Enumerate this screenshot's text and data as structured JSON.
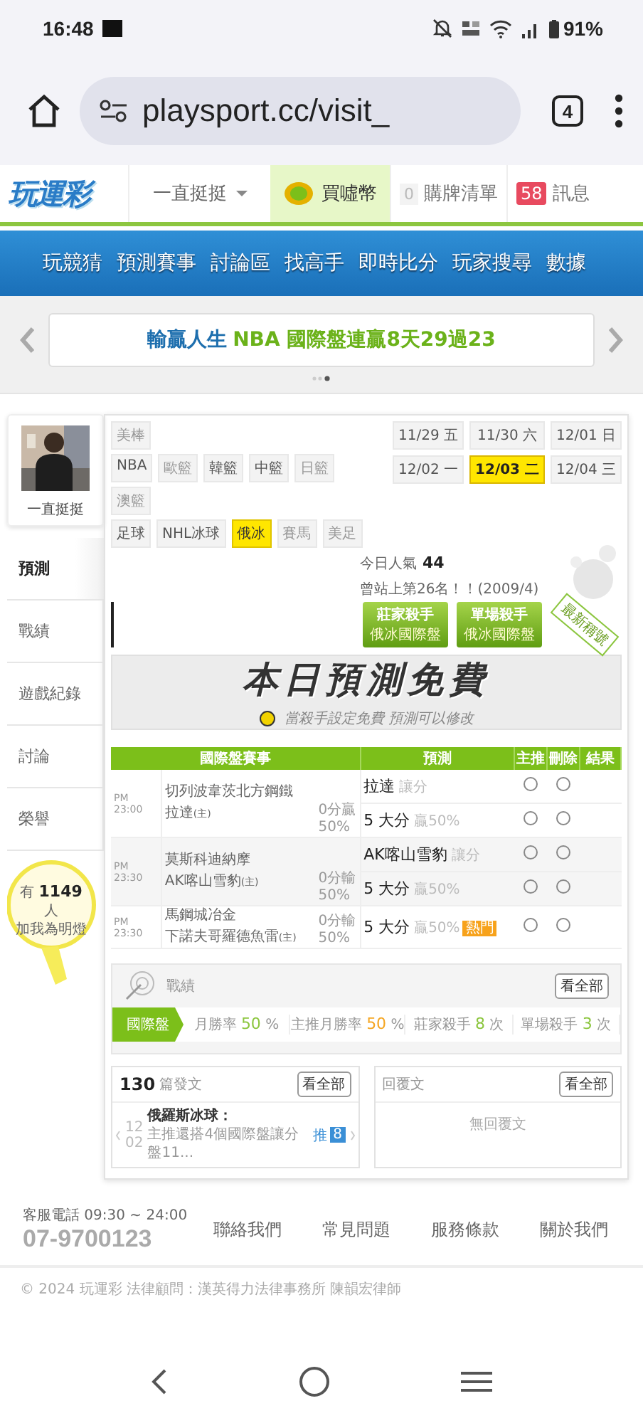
{
  "status_bar": {
    "time": "16:48",
    "battery": "91%"
  },
  "browser": {
    "url": "playsport.cc/visit_",
    "tab_count": "4"
  },
  "site_header": {
    "logo": "玩運彩",
    "user": "一直挺挺",
    "buy_coins": "買噓幣",
    "cart": {
      "count": "0",
      "label": "購牌清單"
    },
    "messages": {
      "count": "58",
      "label": "訊息"
    }
  },
  "main_nav": [
    "玩競猜",
    "預測賽事",
    "討論區",
    "找高手",
    "即時比分",
    "玩家搜尋",
    "數據"
  ],
  "banner": {
    "author": "輸贏人生",
    "headline": "NBA 國際盤連贏8天29過23"
  },
  "profile": {
    "name": "一直挺挺",
    "menu": [
      {
        "label": "預測",
        "selected": true
      },
      {
        "label": "戰績",
        "selected": false
      },
      {
        "label": "遊戲紀錄",
        "selected": false
      },
      {
        "label": "討論",
        "selected": false
      },
      {
        "label": "榮譽",
        "selected": false
      }
    ],
    "fans": {
      "prefix": "有",
      "count": "1149",
      "suffix": "人",
      "caption": "加我為明燈"
    }
  },
  "sports": [
    {
      "items": [
        {
          "label": "美棒",
          "disabled": true,
          "selected": false
        }
      ]
    },
    {
      "items": [
        {
          "label": "NBA",
          "disabled": false,
          "selected": false
        },
        {
          "label": "歐籃",
          "disabled": true,
          "selected": false
        },
        {
          "label": "韓籃",
          "disabled": false,
          "selected": false
        },
        {
          "label": "中籃",
          "disabled": false,
          "selected": false
        },
        {
          "label": "日籃",
          "disabled": true,
          "selected": false
        }
      ]
    },
    {
      "items": [
        {
          "label": "澳籃",
          "disabled": true,
          "selected": false
        }
      ]
    },
    {
      "items": [
        {
          "label": "足球",
          "disabled": false,
          "selected": false
        },
        {
          "label": "NHL冰球",
          "disabled": false,
          "selected": false
        },
        {
          "label": "俄冰",
          "disabled": false,
          "selected": true
        },
        {
          "label": "賽馬",
          "disabled": true,
          "selected": false
        },
        {
          "label": "美足",
          "disabled": true,
          "selected": false
        }
      ]
    }
  ],
  "dates": [
    {
      "date": "11/29",
      "weekday": "五",
      "selected": false
    },
    {
      "date": "11/30",
      "weekday": "六",
      "selected": false
    },
    {
      "date": "12/01",
      "weekday": "日",
      "selected": false
    },
    {
      "date": "12/02",
      "weekday": "一",
      "selected": false
    },
    {
      "date": "12/03",
      "weekday": "二",
      "selected": true
    },
    {
      "date": "12/04",
      "weekday": "三",
      "selected": false
    }
  ],
  "popularity": {
    "label": "今日人氣",
    "value": "44",
    "note": "曾站上第26名！！(2009/4)"
  },
  "badges": [
    {
      "title": "莊家殺手",
      "subtitle": "俄冰國際盤"
    },
    {
      "title": "單場殺手",
      "subtitle": "俄冰國際盤"
    }
  ],
  "ribbon": "最新稱號",
  "free_notice": {
    "title": "本日預測免費",
    "subtitle": "當殺手設定免費 預測可以修改"
  },
  "predictions": {
    "columns": [
      "國際盤賽事",
      "預測",
      "主推",
      "刪除",
      "結果"
    ],
    "games": [
      {
        "time": "PM 23:00",
        "away": "切列波韋茨北方鋼鐵",
        "home": "拉達",
        "home_mark": "(主)",
        "line": "0分贏",
        "line_rate": "50%",
        "picks": [
          {
            "main": "拉達",
            "note": "讓分",
            "main_pick": false,
            "delete": false
          },
          {
            "main": "5 大分",
            "note": "贏50%",
            "main_pick": false,
            "delete": false
          }
        ]
      },
      {
        "time": "PM 23:30",
        "away": "莫斯科迪納摩",
        "home": "AK喀山雪豹",
        "home_mark": "(主)",
        "line": "0分輸",
        "line_rate": "50%",
        "picks": [
          {
            "main": "AK喀山雪豹",
            "note": "讓分",
            "main_pick": false,
            "delete": false
          },
          {
            "main": "5 大分",
            "note": "贏50%",
            "main_pick": false,
            "delete": false
          }
        ]
      },
      {
        "time": "PM 23:30",
        "away": "馬鋼城冶金",
        "home": "下諾夫哥羅德魚雷",
        "home_mark": "(主)",
        "line": "0分輸",
        "line_rate": "50%",
        "picks": [
          {
            "main": "5 大分",
            "note": "贏50%",
            "tag": "熱門",
            "main_pick": false,
            "delete": false
          }
        ]
      }
    ]
  },
  "record": {
    "title": "戰績",
    "view_all": "看全部",
    "tab": "國際盤",
    "stats": [
      {
        "label": "月勝率",
        "value": "50",
        "unit": "%",
        "color": "#8cc63f"
      },
      {
        "label": "主推月勝率",
        "value": "50",
        "unit": "%",
        "color": "#f5a623"
      },
      {
        "label": "莊家殺手",
        "value": "8",
        "unit": "次",
        "color": "#8cc63f"
      },
      {
        "label": "單場殺手",
        "value": "3",
        "unit": "次",
        "color": "#8cc63f"
      }
    ]
  },
  "posts": {
    "count": "130",
    "label": "篇發文",
    "view_all": "看全部",
    "items": [
      {
        "month": "12",
        "day": "02",
        "title": "俄羅斯冰球：",
        "excerpt": "主推還搭4個國際盤讓分盤11...",
        "recommend": "推",
        "votes": "8"
      }
    ]
  },
  "replies": {
    "label": "回覆文",
    "view_all": "看全部",
    "empty": "無回覆文"
  },
  "footer": {
    "hotline": "客服電話 09:30 ~ 24:00",
    "phone": "07-9700123",
    "links": [
      "聯絡我們",
      "常見問題",
      "服務條款",
      "關於我們"
    ],
    "copyright": "© 2024 玩運彩 法律顧問：漢英得力法律事務所 陳韻宏律師"
  }
}
